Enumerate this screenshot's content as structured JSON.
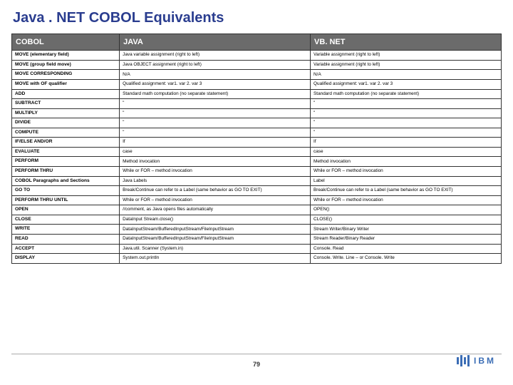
{
  "title": "Java . NET COBOL Equivalents",
  "page_number": "79",
  "logo_text": "IBM",
  "columns": [
    "COBOL",
    "JAVA",
    "VB. NET"
  ],
  "rows": [
    {
      "cobol": "MOVE (elementary field)",
      "java": "Java variable assignment (right to left)",
      "vbnet": "Variable assignment (right to left)"
    },
    {
      "cobol": "MOVE (group field move)",
      "java": "Java OBJECT assignment (right to left)",
      "vbnet": "Variable assignment (right to left)"
    },
    {
      "cobol": "MOVE CORRESPONDING",
      "java": "N/A",
      "vbnet": "N/A"
    },
    {
      "cobol": "MOVE with OF qualifier",
      "java": "Qualified assignment: var1. var 2. var 3",
      "vbnet": "Qualified assignment: var1. var 2. var 3"
    },
    {
      "cobol": "ADD",
      "java": "Standard math computation (no separate statement)",
      "vbnet": "Standard math computation (no separate statement)"
    },
    {
      "cobol": "SUBTRACT",
      "java": "\"",
      "vbnet": "\""
    },
    {
      "cobol": "MULTIPLY",
      "java": "\"",
      "vbnet": "\""
    },
    {
      "cobol": "DIVIDE",
      "java": "\"",
      "vbnet": "\""
    },
    {
      "cobol": "COMPUTE",
      "java": "\"",
      "vbnet": "\""
    },
    {
      "cobol": "IF/ELSE AND/OR",
      "java": "If",
      "vbnet": "If"
    },
    {
      "cobol": "EVALUATE",
      "java": "case",
      "vbnet": "case"
    },
    {
      "cobol": "PERFORM",
      "java": "Method invocation",
      "vbnet": "Method invocation"
    },
    {
      "cobol": "PERFORM THRU",
      "java": "While or FOR – method invocation",
      "vbnet": "While or FOR – method invocation"
    },
    {
      "cobol": "COBOL Paragraphs and Sections",
      "java": "Java Labels",
      "vbnet": "Label"
    },
    {
      "cobol": "GO TO",
      "java": "Break/Continue can refer to a Label (same behavior as GO TO EXIT)",
      "vbnet": "Break/Continue can refer to a Label (same behavior as GO TO EXIT)"
    },
    {
      "cobol": "PERFORM THRU UNTIL",
      "java": "While or FOR – method invocation",
      "vbnet": "While or FOR – method invocation"
    },
    {
      "cobol": "OPEN",
      "java": "//comment, as Java opens files automatically",
      "vbnet": "OPEN()"
    },
    {
      "cobol": "CLOSE",
      "java": "DataInput Stream.close()",
      "vbnet": "CLOSE()"
    },
    {
      "cobol": "WRITE",
      "java": "DataInputStream/BufferedInputStream/FileInputStream",
      "vbnet": "Stream Writer/Binary Writer"
    },
    {
      "cobol": "READ",
      "java": "DataInputStream/BufferedInputStream/FileInputStream",
      "vbnet": "Stream Reader/Binary Reader"
    },
    {
      "cobol": "ACCEPT",
      "java": "Java.util. Scanner (System.in)",
      "vbnet": "Console. Read"
    },
    {
      "cobol": "DISPLAY",
      "java": "System.out.println",
      "vbnet": "Console. Write. Line – or Console. Write"
    }
  ]
}
